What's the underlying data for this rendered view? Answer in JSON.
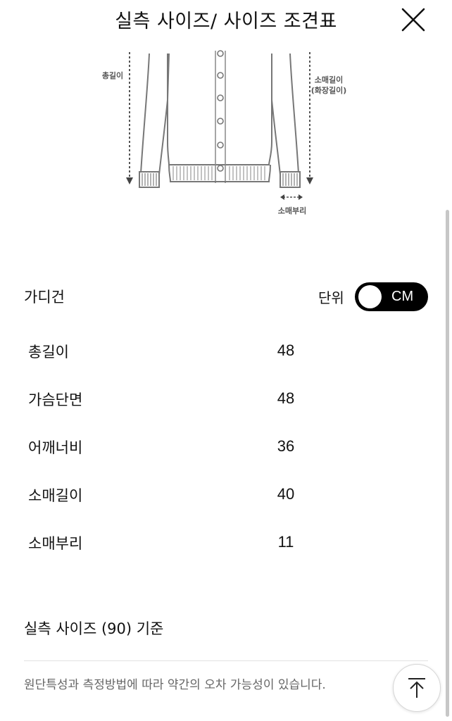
{
  "header": {
    "title": "실측 사이즈/ 사이즈 조견표"
  },
  "illustration": {
    "label_total_length": "총길이",
    "label_sleeve_length": "소매길이",
    "label_sleeve_length_sub": "(화장길이)",
    "label_cuff": "소매부리"
  },
  "section": {
    "title": "가디건",
    "unit_label": "단위",
    "unit_value": "CM"
  },
  "measurements": [
    {
      "label": "총길이",
      "value": "48"
    },
    {
      "label": "가슴단면",
      "value": "48"
    },
    {
      "label": "어깨너비",
      "value": "36"
    },
    {
      "label": "소매길이",
      "value": "40"
    },
    {
      "label": "소매부리",
      "value": "11"
    }
  ],
  "footer": {
    "basis": "실측 사이즈 (90) 기준",
    "note": "원단특성과 측정방법에 따라 약간의 오차 가능성이 있습니다."
  }
}
